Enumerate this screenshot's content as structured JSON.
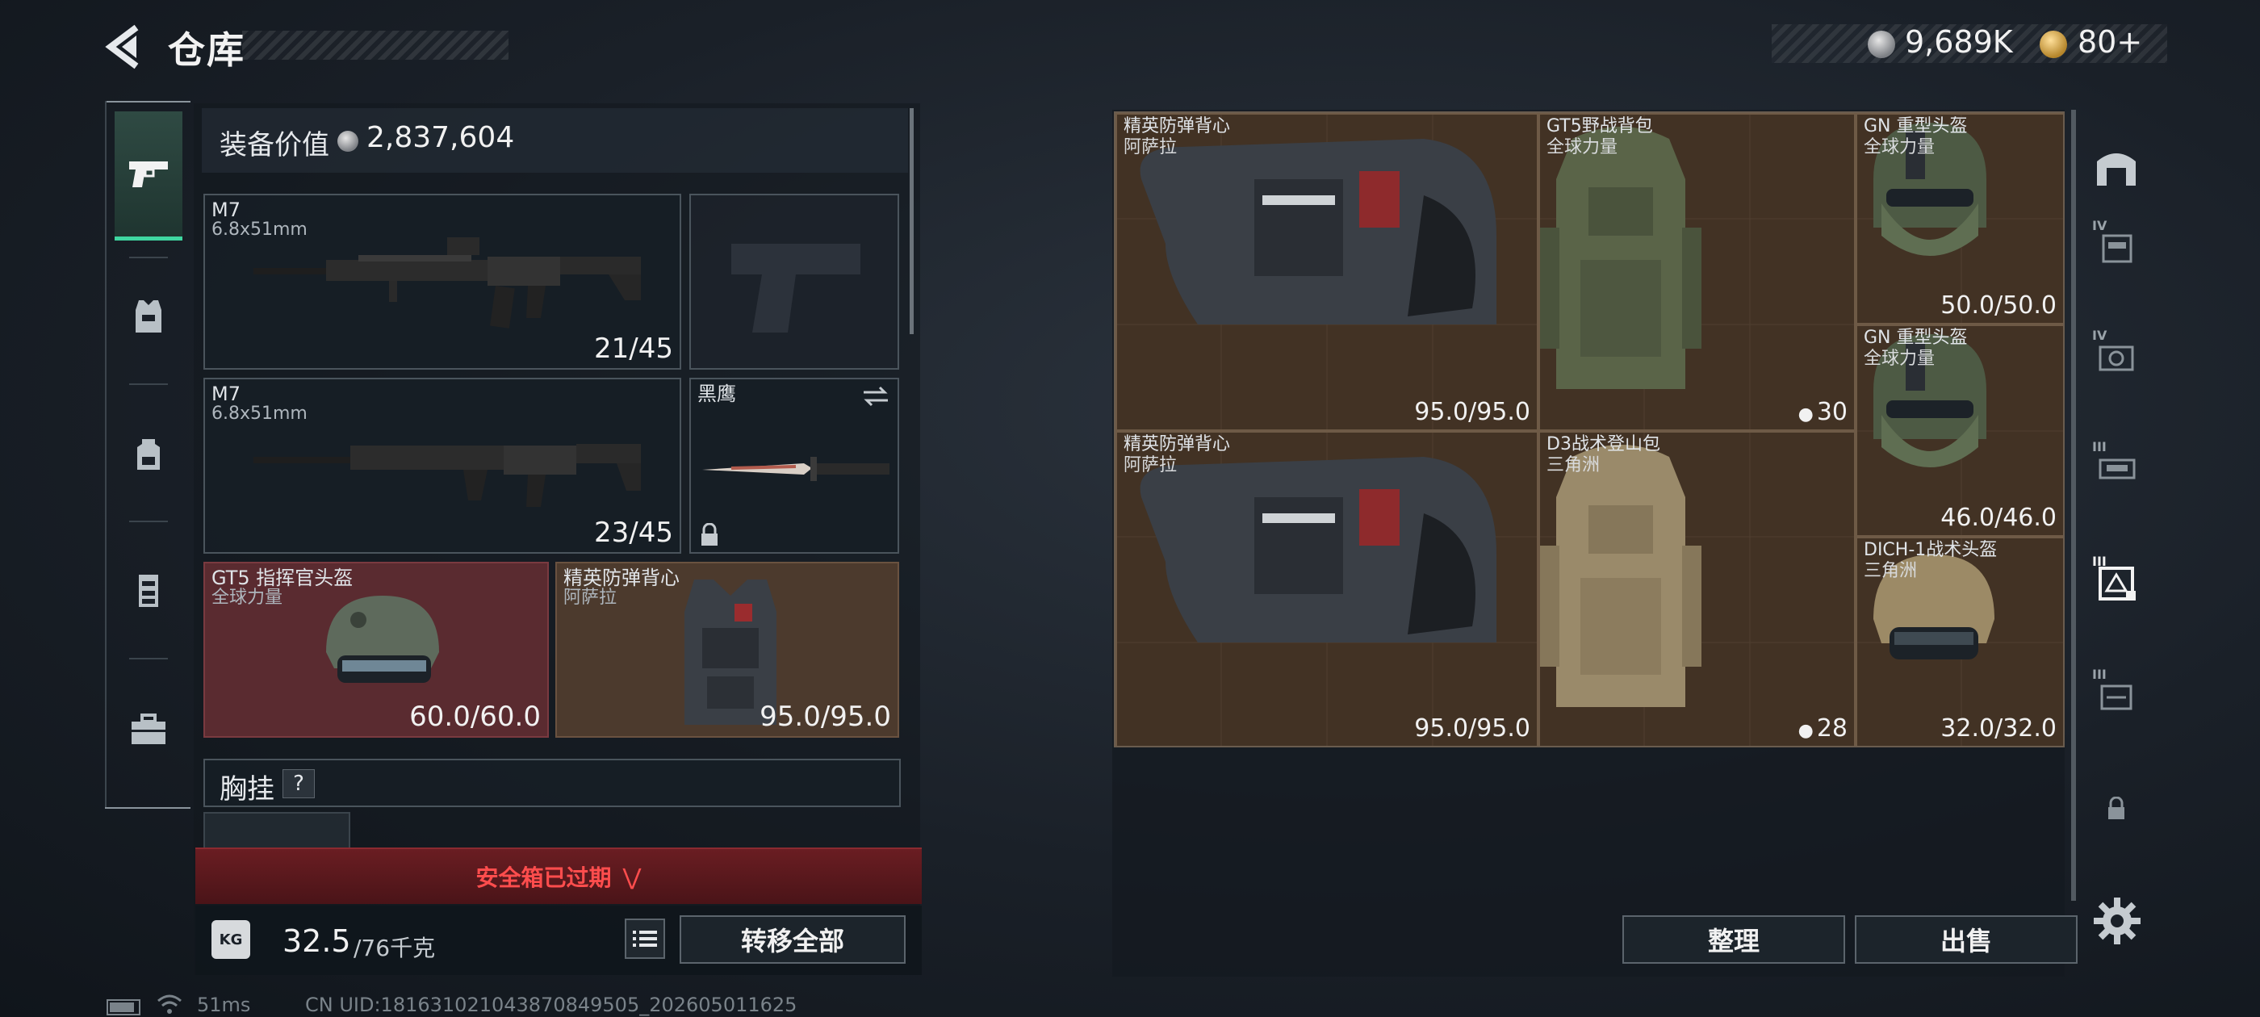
{
  "header": {
    "title": "仓库",
    "money": "9,689K",
    "tickets": "80+"
  },
  "left_tabs": [
    {
      "name": "weapons",
      "active": true
    },
    {
      "name": "armor"
    },
    {
      "name": "backpack"
    },
    {
      "name": "chest-rig"
    },
    {
      "name": "case"
    }
  ],
  "loadout": {
    "equip_value_label": "装备价值",
    "equip_value": "2,837,604",
    "primary_1": {
      "name": "M7",
      "caliber": "6.8x51mm",
      "ammo": "21/45"
    },
    "primary_2": {
      "name": "M7",
      "caliber": "6.8x51mm",
      "ammo": "23/45"
    },
    "melee": {
      "name": "黑鹰"
    },
    "helmet": {
      "name": "GT5 指挥官头盔",
      "brand": "全球力量",
      "durability": "60.0/60.0"
    },
    "armor": {
      "name": "精英防弹背心",
      "brand": "阿萨拉",
      "durability": "95.0/95.0"
    },
    "chest_rig_label": "胸挂",
    "help": "?"
  },
  "safebox_banner": "安全箱已过期",
  "weight": {
    "current": "32.5",
    "max": "/76千克",
    "icon_label": "KG"
  },
  "buttons": {
    "transfer_all": "转移全部",
    "sort": "整理",
    "sell": "出售"
  },
  "status": {
    "ping": "51ms",
    "uid": "CN UID:18163102104387084950​5_202605011625"
  },
  "storage_items": [
    {
      "name": "精英防弹背心",
      "sub": "阿萨拉",
      "value": "95.0/95.0"
    },
    {
      "name": "GT5野战背包",
      "sub": "全球力量",
      "value": "30"
    },
    {
      "name": "GN 重型头盔",
      "sub": "全球力量",
      "value": "50.0/50.0"
    },
    {
      "name": "GN 重型头盔",
      "sub": "全球力量",
      "value": "46.0/46.0"
    },
    {
      "name": "精英防弹背心",
      "sub": "阿萨拉",
      "value": "95.0/95.0"
    },
    {
      "name": "D3战术登山包",
      "sub": "三角洲",
      "value": "28"
    },
    {
      "name": "DICH-1战术头盔",
      "sub": "三角洲",
      "value": "32.0/32.0"
    }
  ],
  "filters": [
    {
      "name": "filter-all",
      "tier": ""
    },
    {
      "name": "filter-armor-iv",
      "tier": "IV"
    },
    {
      "name": "filter-helmet-iv",
      "tier": "IV"
    },
    {
      "name": "filter-rig-iii",
      "tier": "III"
    },
    {
      "name": "filter-equipment",
      "tier": "III",
      "active": true
    },
    {
      "name": "filter-bag-iii",
      "tier": "III"
    },
    {
      "name": "filter-locked",
      "tier": ""
    }
  ],
  "colors": {
    "accent": "#3fd6a0",
    "alert_red": "#ff4d4d",
    "helmet_slot": "#5a2b30",
    "armor_slot": "#4c3a2d"
  }
}
